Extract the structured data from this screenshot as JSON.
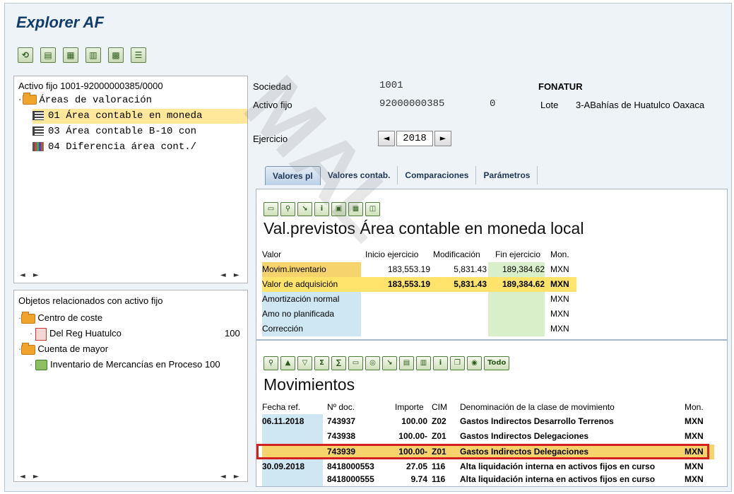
{
  "window": {
    "title": "Explorer AF"
  },
  "toolbar": {
    "icons": [
      "refresh-icon",
      "display-icon",
      "table-icon",
      "chart-icon",
      "layout-icon",
      "list-icon"
    ],
    "glyphs": [
      "⟲",
      "▤",
      "▦",
      "▥",
      "▩",
      "☰"
    ]
  },
  "tree": {
    "header": "Activo fijo 1001-92000000385/0000",
    "root": "Áreas de valoración",
    "items": [
      {
        "label": "01 Área contable en moneda",
        "selected": true
      },
      {
        "label": "03 Área contable B-10 con",
        "selected": false
      },
      {
        "label": "04 Diferencia área cont./",
        "selected": false
      }
    ],
    "scroll": "◄ ►"
  },
  "related": {
    "header": "Objetos relacionados con activo fijo",
    "groups": [
      {
        "label": "Centro de coste",
        "child": "Del Reg Huatulco",
        "child_value": "100"
      },
      {
        "label": "Cuenta de mayor",
        "child": "Inventario de Mercancías en Proceso",
        "child_value": "100"
      }
    ]
  },
  "header": {
    "sociedad_label": "Sociedad",
    "sociedad_value": "1001",
    "company_name": "FONATUR",
    "activo_label": "Activo fijo",
    "activo_value": "92000000385",
    "sub_value": "0",
    "lote_label": "Lote",
    "lote_value": "3-ABahías de Huatulco Oaxaca",
    "ejercicio_label": "Ejercicio",
    "ejercicio_value": "2018",
    "prev_glyph": "◄",
    "next_glyph": "►"
  },
  "tabs": [
    "Valores pl",
    "Valores contab.",
    "Comparaciones",
    "Parámetros"
  ],
  "valores": {
    "title": "Val.previstos Área contable en moneda local",
    "columns": [
      "Valor",
      "Inicio ejercicio",
      "Modificación",
      "Fin ejercicio",
      "Mon."
    ],
    "rows": [
      {
        "label": "Movim.inventario",
        "inicio": "183,553.19",
        "mod": "5,831.43",
        "fin": "189,384.62",
        "mon": "MXN"
      },
      {
        "label": "Valor de adquisición",
        "inicio": "183,553.19",
        "mod": "5,831.43",
        "fin": "189,384.62",
        "mon": "MXN"
      },
      {
        "label": "Amortización normal",
        "inicio": "",
        "mod": "",
        "fin": "",
        "mon": "MXN"
      },
      {
        "label": "Amo no planificada",
        "inicio": "",
        "mod": "",
        "fin": "",
        "mon": "MXN"
      },
      {
        "label": "Corrección",
        "inicio": "",
        "mod": "",
        "fin": "",
        "mon": "MXN"
      }
    ]
  },
  "movimientos": {
    "title": "Movimientos",
    "todo_label": "Todo",
    "columns": [
      "Fecha ref.",
      "Nº doc.",
      "Importe",
      "CIM",
      "Denominación de la clase de movimiento",
      "Mon."
    ],
    "rows": [
      {
        "fecha": "06.11.2018",
        "doc": "743937",
        "importe": "100.00",
        "cim": "Z02",
        "denom": "Gastos Indirectos Desarrollo Terrenos",
        "mon": "MXN"
      },
      {
        "fecha": "",
        "doc": "743938",
        "importe": "100.00-",
        "cim": "Z01",
        "denom": "Gastos Indirectos Delegaciones",
        "mon": "MXN"
      },
      {
        "fecha": "",
        "doc": "743939",
        "importe": "100.00-",
        "cim": "Z01",
        "denom": "Gastos Indirectos Delegaciones",
        "mon": "MXN"
      },
      {
        "fecha": "30.09.2018",
        "doc": "8418000553",
        "importe": "27.05",
        "cim": "116",
        "denom": "Alta liquidación interna en activos fijos en curso",
        "mon": "MXN"
      },
      {
        "fecha": "",
        "doc": "8418000555",
        "importe": "9.74",
        "cim": "116",
        "denom": "Alta liquidación interna en activos fijos en curso",
        "mon": "MXN"
      }
    ]
  },
  "watermark": "MAL"
}
